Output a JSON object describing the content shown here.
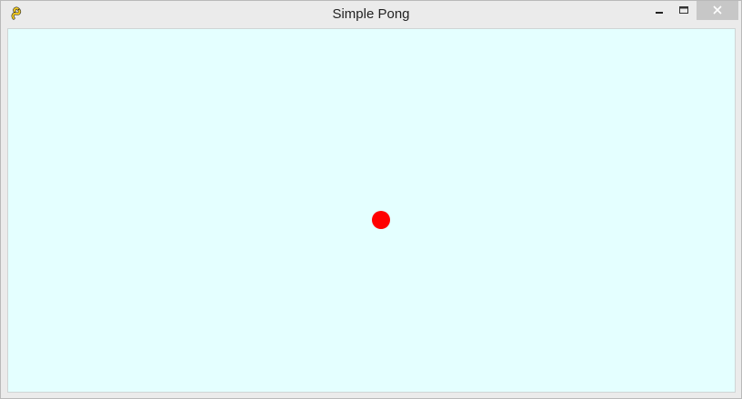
{
  "window": {
    "title": "Simple Pong",
    "app_icon": "pygame-snake-icon",
    "controls": [
      "minimize-icon",
      "maximize-icon",
      "close-icon"
    ]
  },
  "game": {
    "background_color": "#e4ffff",
    "ball_color": "#ff0000"
  }
}
